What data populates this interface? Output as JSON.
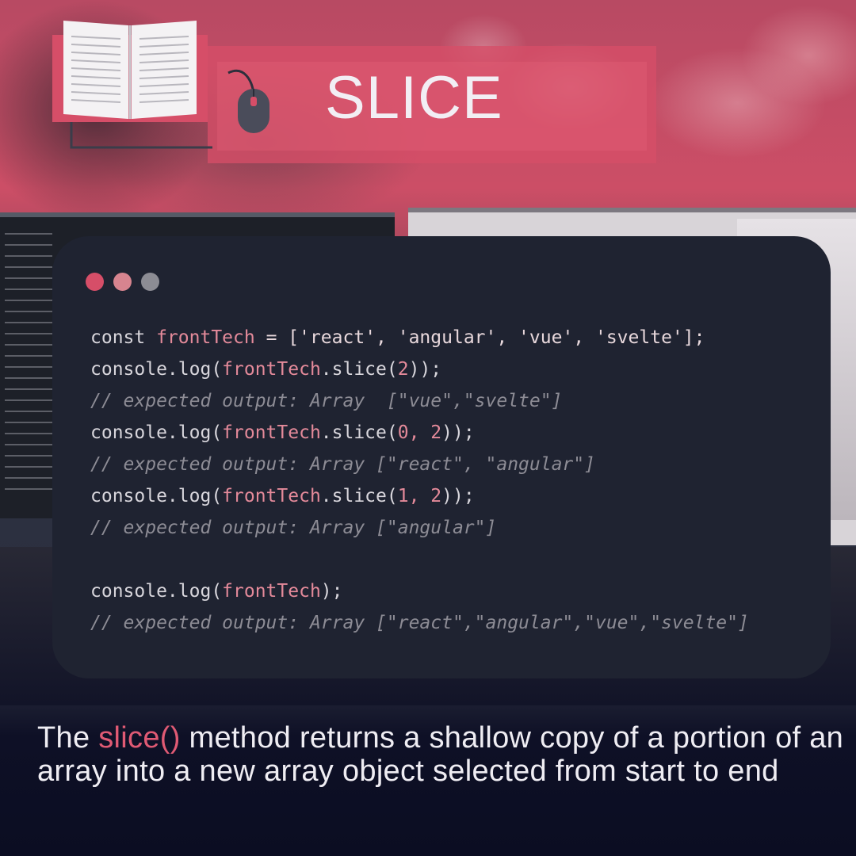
{
  "header": {
    "title": "SLICE"
  },
  "code_window": {
    "lines": [
      {
        "type": "code",
        "parts": [
          {
            "t": "const ",
            "c": "kw"
          },
          {
            "t": "frontTech",
            "c": "var"
          },
          {
            "t": " = ['react', 'angular', 'vue', 'svelte'];",
            "c": "str"
          }
        ]
      },
      {
        "type": "code",
        "parts": [
          {
            "t": "console.log(",
            "c": "kw"
          },
          {
            "t": "frontTech",
            "c": "var"
          },
          {
            "t": ".slice(",
            "c": "kw"
          },
          {
            "t": "2",
            "c": "num"
          },
          {
            "t": "));",
            "c": "kw"
          }
        ]
      },
      {
        "type": "comment",
        "parts": [
          {
            "t": "// expected output: Array  [\"vue\",\"svelte\"]",
            "c": "cm"
          }
        ]
      },
      {
        "type": "code",
        "parts": [
          {
            "t": "console.log(",
            "c": "kw"
          },
          {
            "t": "frontTech",
            "c": "var"
          },
          {
            "t": ".slice(",
            "c": "kw"
          },
          {
            "t": "0, 2",
            "c": "num"
          },
          {
            "t": "));",
            "c": "kw"
          }
        ]
      },
      {
        "type": "comment",
        "parts": [
          {
            "t": "// expected output: Array [\"react\", \"angular\"]",
            "c": "cm"
          }
        ]
      },
      {
        "type": "code",
        "parts": [
          {
            "t": "console.log(",
            "c": "kw"
          },
          {
            "t": "frontTech",
            "c": "var"
          },
          {
            "t": ".slice(",
            "c": "kw"
          },
          {
            "t": "1, 2",
            "c": "num"
          },
          {
            "t": "));",
            "c": "kw"
          }
        ]
      },
      {
        "type": "comment",
        "parts": [
          {
            "t": "// expected output: Array [\"angular\"]",
            "c": "cm"
          }
        ]
      },
      {
        "type": "blank",
        "parts": []
      },
      {
        "type": "code",
        "parts": [
          {
            "t": "console.log(",
            "c": "kw"
          },
          {
            "t": "frontTech",
            "c": "var"
          },
          {
            "t": ");",
            "c": "kw"
          }
        ]
      },
      {
        "type": "comment",
        "parts": [
          {
            "t": "// expected output: Array [\"react\",\"angular\",\"vue\",\"svelte\"]",
            "c": "cm"
          }
        ]
      }
    ]
  },
  "description": {
    "prefix": "The ",
    "highlight": "slice()",
    "suffix": " method returns a shallow copy of a portion of an array into a new array object selected from start to end"
  },
  "colors": {
    "accent": "#e05a74",
    "card_bg": "#1f2331",
    "dot_red": "#d64e68",
    "dot_pink": "#d7848f",
    "dot_gray": "#8c8c94"
  },
  "icons": [
    "book-icon",
    "mouse-icon"
  ]
}
